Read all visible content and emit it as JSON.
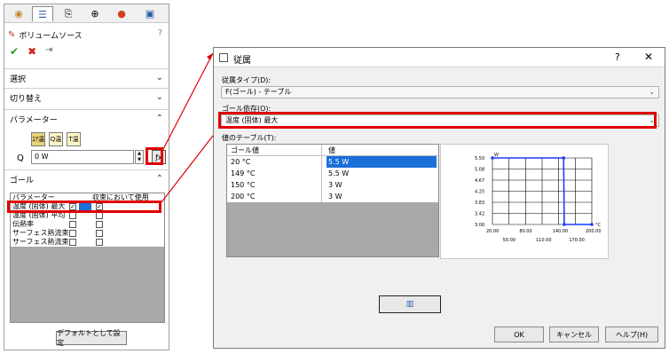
{
  "panel": {
    "tabs": [
      "feature-manager-icon",
      "property-manager-icon",
      "config-manager-icon",
      "dimxpert-icon",
      "appearance-icon",
      "flow-analysis-icon"
    ],
    "feature_title": "ボリュームソース",
    "help": "?",
    "sections": {
      "selection": "選択",
      "toggle": "切り替え",
      "parameters": "パラメーター",
      "goals": "ゴール"
    },
    "param_buttons": [
      "ｺｱ温",
      "Q温",
      "T温"
    ],
    "q_label": "Q",
    "q_value": "0 W",
    "goal_table": {
      "headers": [
        "パラメーター",
        "収束において使用"
      ],
      "rows": [
        {
          "name": "温度 (固体) 最大",
          "checked1": true,
          "checked2": true
        },
        {
          "name": "温度 (固体) 平均",
          "checked1": false,
          "checked2": false
        },
        {
          "name": "伝熱率",
          "checked1": false,
          "checked2": false
        },
        {
          "name": "サーフェス熱流束",
          "checked1": false,
          "checked2": false
        },
        {
          "name": "サーフェス熱流束",
          "checked1": false,
          "checked2": false
        }
      ]
    },
    "default_button": "デフォルトとして設定"
  },
  "dialog": {
    "title": "従属",
    "help": "?",
    "close": "✕",
    "dependency_type_label": "従属タイプ(D):",
    "dependency_type_value": "F(ゴール) - テーブル",
    "goal_dependency_label": "ゴール依存(O):",
    "goal_dependency_value": "温度 (固体) 最大",
    "value_table_label": "値のテーブル(T):",
    "table_headers": [
      "ゴール値",
      "値"
    ],
    "table_rows": [
      {
        "goal": "20 °C",
        "value": "5.5 W"
      },
      {
        "goal": "149 °C",
        "value": "5.5 W"
      },
      {
        "goal": "150 °C",
        "value": "3 W"
      },
      {
        "goal": "200 °C",
        "value": "3 W"
      }
    ],
    "ok": "OK",
    "cancel": "キャンセル",
    "helpbtn": "ヘルプ(H)"
  },
  "chart_data": {
    "type": "line",
    "title": "",
    "xlabel": "°C",
    "ylabel": "W",
    "x": [
      20,
      149,
      150,
      200
    ],
    "series": [
      {
        "values": [
          5.5,
          5.5,
          0.0,
          0.0
        ]
      }
    ],
    "y_tick_labels": [
      "5.50",
      "5.08",
      "4.67",
      "4.25",
      "3.83",
      "3.42",
      "3.00"
    ],
    "x_tick_labels_upper": [
      "20.00",
      "80.00",
      "140.00",
      "200.00"
    ],
    "x_tick_labels_lower": [
      "50.00",
      "110.00",
      "170.00"
    ],
    "grid": true,
    "line_color": "#1a3cff"
  }
}
